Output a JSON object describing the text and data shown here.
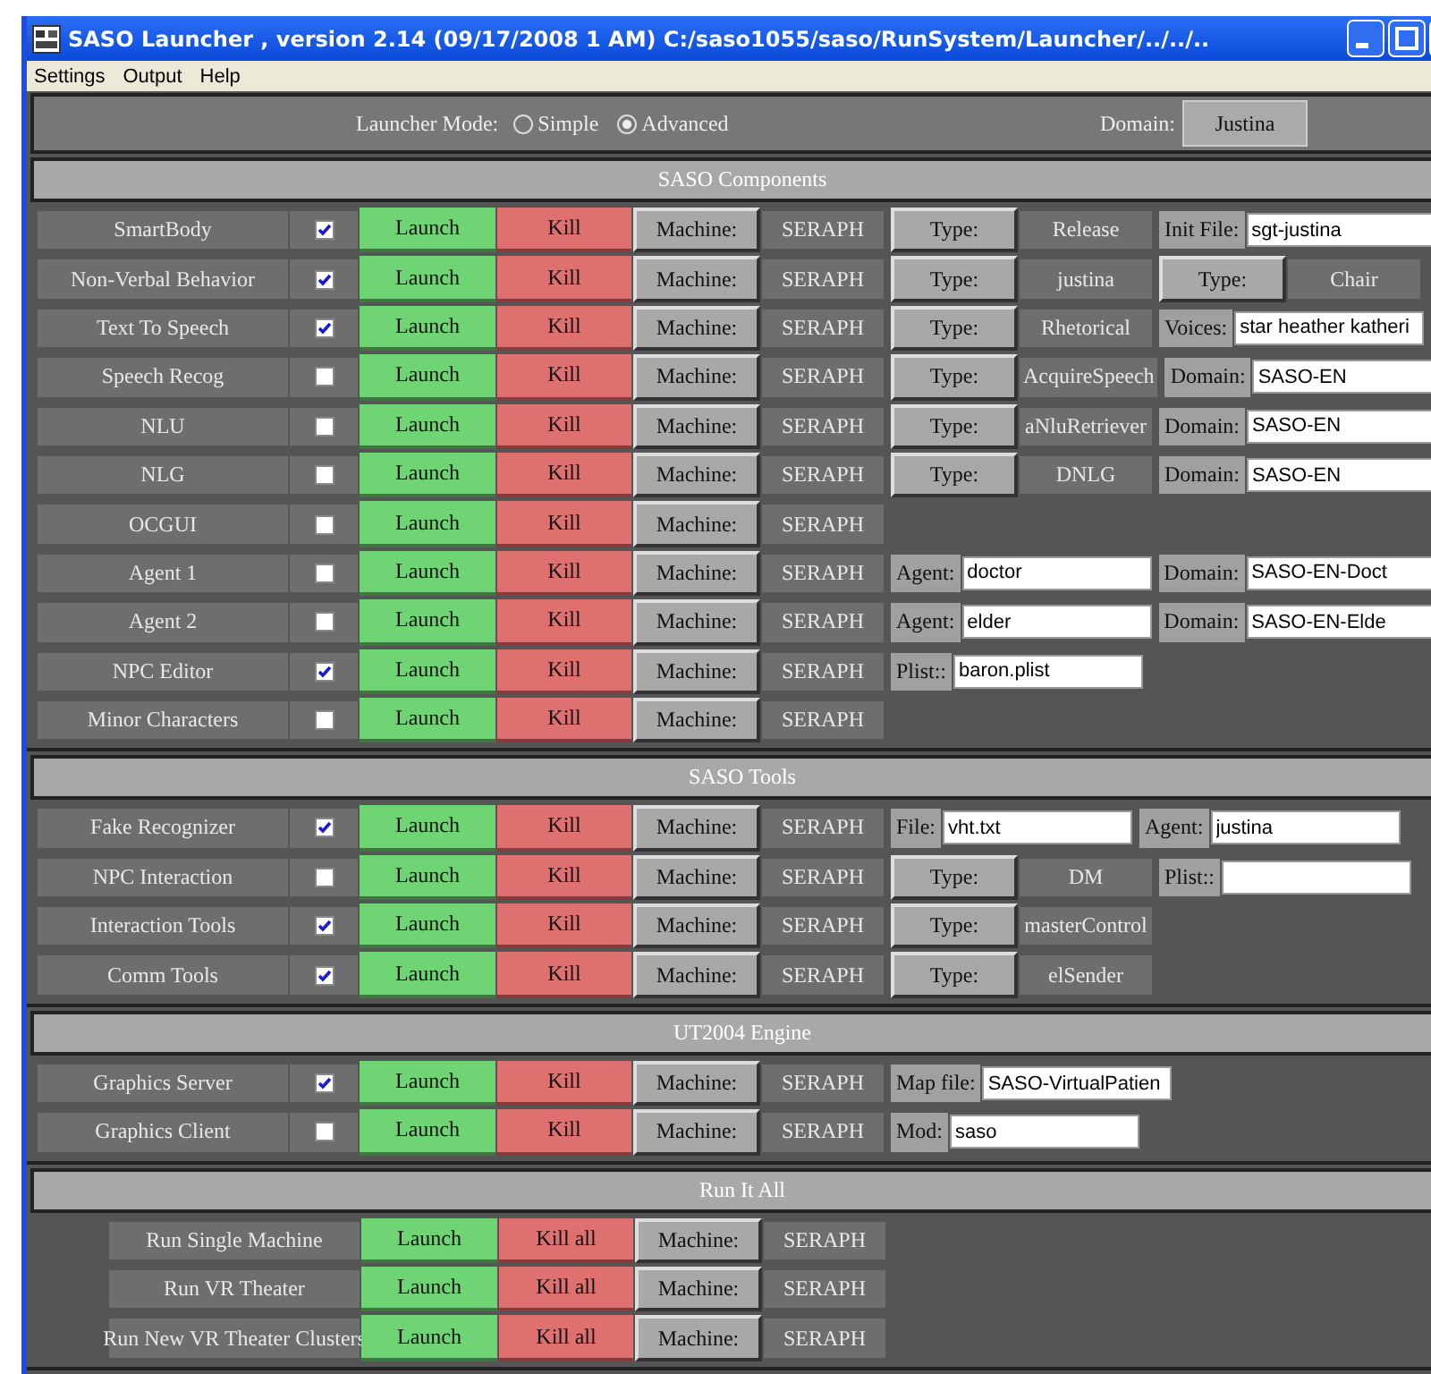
{
  "window": {
    "title": "SASO Launcher , version 2.14 (09/17/2008 1 AM) C:/saso1055/saso/RunSystem/Launcher/../../.."
  },
  "menu": [
    "Settings",
    "Output",
    "Help"
  ],
  "mode_bar": {
    "label": "Launcher Mode:",
    "options": [
      {
        "label": "Simple",
        "selected": false
      },
      {
        "label": "Advanced",
        "selected": true
      }
    ],
    "domain_label": "Domain:",
    "domain": "Justina"
  },
  "sections": [
    {
      "title": "SASO Components",
      "rows": [
        {
          "name": "SmartBody",
          "checked": true,
          "launch": "Launch",
          "kill": "Kill",
          "machine_label": "Machine:",
          "machine": "SERAPH",
          "extras": [
            {
              "kind": "button",
              "text": "Type:"
            },
            {
              "kind": "value",
              "text": "Release"
            },
            {
              "kind": "label",
              "text": "Init File:"
            },
            {
              "kind": "field",
              "text": "sgt-justina"
            }
          ]
        },
        {
          "name": "Non-Verbal Behavior",
          "checked": true,
          "launch": "Launch",
          "kill": "Kill",
          "machine_label": "Machine:",
          "machine": "SERAPH",
          "extras": [
            {
              "kind": "button",
              "text": "Type:"
            },
            {
              "kind": "value",
              "text": "justina"
            },
            {
              "kind": "button",
              "text": "Type:"
            },
            {
              "kind": "value",
              "text": "Chair"
            }
          ]
        },
        {
          "name": "Text To Speech",
          "checked": true,
          "launch": "Launch",
          "kill": "Kill",
          "machine_label": "Machine:",
          "machine": "SERAPH",
          "extras": [
            {
              "kind": "button",
              "text": "Type:"
            },
            {
              "kind": "value",
              "text": "Rhetorical"
            },
            {
              "kind": "label",
              "text": "Voices:"
            },
            {
              "kind": "field",
              "text": "star heather katheri"
            }
          ]
        },
        {
          "name": "Speech Recog",
          "checked": false,
          "launch": "Launch",
          "kill": "Kill",
          "machine_label": "Machine:",
          "machine": "SERAPH",
          "extras": [
            {
              "kind": "button",
              "text": "Type:"
            },
            {
              "kind": "value",
              "text": "AcquireSpeech"
            },
            {
              "kind": "label",
              "text": "Domain:"
            },
            {
              "kind": "field",
              "text": "SASO-EN"
            }
          ]
        },
        {
          "name": "NLU",
          "checked": false,
          "launch": "Launch",
          "kill": "Kill",
          "machine_label": "Machine:",
          "machine": "SERAPH",
          "extras": [
            {
              "kind": "button",
              "text": "Type:"
            },
            {
              "kind": "value",
              "text": "aNluRetriever"
            },
            {
              "kind": "label",
              "text": "Domain:"
            },
            {
              "kind": "field",
              "text": "SASO-EN"
            }
          ]
        },
        {
          "name": "NLG",
          "checked": false,
          "launch": "Launch",
          "kill": "Kill",
          "machine_label": "Machine:",
          "machine": "SERAPH",
          "extras": [
            {
              "kind": "button",
              "text": "Type:"
            },
            {
              "kind": "value",
              "text": "DNLG"
            },
            {
              "kind": "label",
              "text": "Domain:"
            },
            {
              "kind": "field",
              "text": "SASO-EN"
            }
          ]
        },
        {
          "name": "OCGUI",
          "checked": false,
          "launch": "Launch",
          "kill": "Kill",
          "machine_label": "Machine:",
          "machine": "SERAPH",
          "extras": []
        },
        {
          "name": "Agent 1",
          "checked": false,
          "launch": "Launch",
          "kill": "Kill",
          "machine_label": "Machine:",
          "machine": "SERAPH",
          "extras": [
            {
              "kind": "label",
              "text": "Agent:"
            },
            {
              "kind": "field",
              "text": "doctor"
            },
            {
              "kind": "label",
              "text": "Domain:"
            },
            {
              "kind": "field",
              "text": "SASO-EN-Doct"
            }
          ]
        },
        {
          "name": "Agent 2",
          "checked": false,
          "launch": "Launch",
          "kill": "Kill",
          "machine_label": "Machine:",
          "machine": "SERAPH",
          "extras": [
            {
              "kind": "label",
              "text": "Agent:"
            },
            {
              "kind": "field",
              "text": "elder"
            },
            {
              "kind": "label",
              "text": "Domain:"
            },
            {
              "kind": "field",
              "text": "SASO-EN-Elde"
            }
          ]
        },
        {
          "name": "NPC Editor",
          "checked": true,
          "launch": "Launch",
          "kill": "Kill",
          "machine_label": "Machine:",
          "machine": "SERAPH",
          "extras": [
            {
              "kind": "label",
              "text": "Plist::"
            },
            {
              "kind": "field",
              "text": "baron.plist"
            }
          ]
        },
        {
          "name": "Minor Characters",
          "checked": false,
          "launch": "Launch",
          "kill": "Kill",
          "machine_label": "Machine:",
          "machine": "SERAPH",
          "extras": []
        }
      ]
    },
    {
      "title": "SASO Tools",
      "rows": [
        {
          "name": "Fake Recognizer",
          "checked": true,
          "launch": "Launch",
          "kill": "Kill",
          "machine_label": "Machine:",
          "machine": "SERAPH",
          "extras": [
            {
              "kind": "label",
              "text": "File:"
            },
            {
              "kind": "field",
              "text": "vht.txt"
            },
            {
              "kind": "label",
              "text": "Agent:"
            },
            {
              "kind": "field",
              "text": "justina"
            }
          ]
        },
        {
          "name": "NPC Interaction",
          "checked": false,
          "launch": "Launch",
          "kill": "Kill",
          "machine_label": "Machine:",
          "machine": "SERAPH",
          "extras": [
            {
              "kind": "button",
              "text": "Type:"
            },
            {
              "kind": "value",
              "text": "DM"
            },
            {
              "kind": "label",
              "text": "Plist::"
            },
            {
              "kind": "field"
            }
          ]
        },
        {
          "name": "Interaction Tools",
          "checked": true,
          "launch": "Launch",
          "kill": "Kill",
          "machine_label": "Machine:",
          "machine": "SERAPH",
          "extras": [
            {
              "kind": "button",
              "text": "Type:"
            },
            {
              "kind": "value",
              "text": "masterControl"
            }
          ]
        },
        {
          "name": "Comm Tools",
          "checked": true,
          "launch": "Launch",
          "kill": "Kill",
          "machine_label": "Machine:",
          "machine": "SERAPH",
          "extras": [
            {
              "kind": "button",
              "text": "Type:"
            },
            {
              "kind": "value",
              "text": "elSender"
            }
          ]
        }
      ]
    },
    {
      "title": "UT2004 Engine",
      "rows": [
        {
          "name": "Graphics Server",
          "checked": true,
          "launch": "Launch",
          "kill": "Kill",
          "machine_label": "Machine:",
          "machine": "SERAPH",
          "extras": [
            {
              "kind": "label",
              "text": "Map file:"
            },
            {
              "kind": "field",
              "text": "SASO-VirtualPatien"
            }
          ]
        },
        {
          "name": "Graphics Client",
          "checked": false,
          "launch": "Launch",
          "kill": "Kill",
          "machine_label": "Machine:",
          "machine": "SERAPH",
          "extras": [
            {
              "kind": "label",
              "text": "Mod:"
            },
            {
              "kind": "field",
              "text": "saso"
            }
          ]
        }
      ]
    },
    {
      "title": "Run It All",
      "rows": [
        {
          "name": "Run Single Machine",
          "launch": "Launch",
          "kill": "Kill all",
          "machine_label": "Machine:",
          "machine": "SERAPH",
          "extras": []
        },
        {
          "name": "Run VR Theater",
          "launch": "Launch",
          "kill": "Kill all",
          "machine_label": "Machine:",
          "machine": "SERAPH",
          "extras": []
        },
        {
          "name": "Run New VR Theater Clusters",
          "launch": "Launch",
          "kill": "Kill all",
          "machine_label": "Machine:",
          "machine": "SERAPH",
          "extras": []
        }
      ]
    }
  ]
}
